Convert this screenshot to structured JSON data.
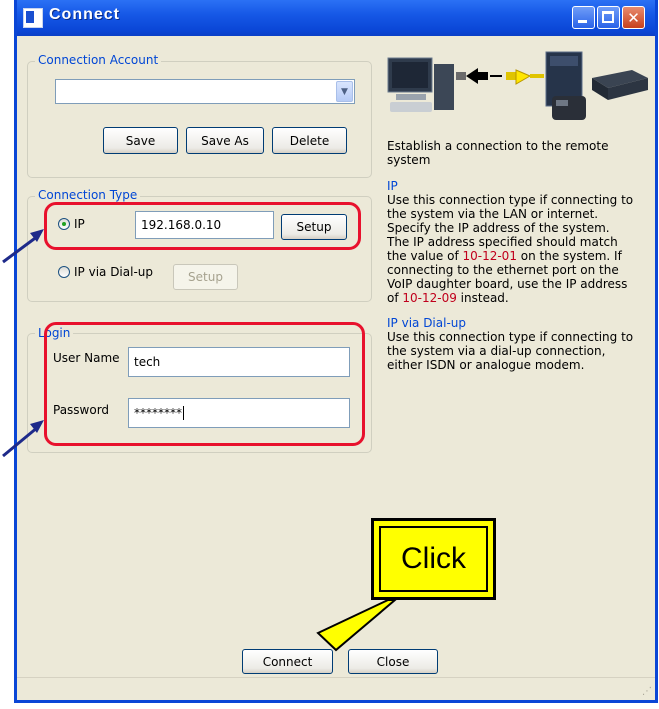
{
  "window": {
    "title": "Connect"
  },
  "connection_account": {
    "legend": "Connection Account",
    "account_select_value": "",
    "save_label": "Save",
    "save_as_label": "Save As",
    "delete_label": "Delete"
  },
  "connection_type": {
    "legend": "Connection Type",
    "ip_label": "IP",
    "ip_value": "192.168.0.10",
    "setup_label": "Setup",
    "dialup_label": "IP via Dial-up",
    "dialup_setup_label": "Setup"
  },
  "login": {
    "legend": "Login",
    "username_label": "User Name",
    "username_value": "tech",
    "password_label": "Password",
    "password_value": "********"
  },
  "info": {
    "intro_line1": "Establish a connection to the remote",
    "intro_line2": "system",
    "ip_heading": "IP",
    "ip_line1": "Use this connection type if connecting to",
    "ip_line2": "the system via the LAN or internet.",
    "ip_line3": "Specify the IP address of the system.",
    "ip_line4": "The IP address specified should match",
    "ip_line5_pre": "the value of ",
    "ip_line5_code": "10-12-01",
    "ip_line5_post": " on the system. If",
    "ip_line6": "connecting to the ethernet port on the",
    "ip_line7": "VoIP daughter board, use the IP address",
    "ip_line8_pre": "of ",
    "ip_line8_code": "10-12-09",
    "ip_line8_post": " instead.",
    "dialup_heading": "IP via Dial-up",
    "dialup_line1": "Use this connection type if connecting to",
    "dialup_line2": "the system via a dial-up connection,",
    "dialup_line3": "either ISDN or analogue modem."
  },
  "buttons": {
    "connect_label": "Connect",
    "close_label": "Close"
  },
  "callout": {
    "text": "Click"
  },
  "colors": {
    "title_bar": "#0a46d6",
    "annotation_red": "#e8112d",
    "callout_yellow": "#ffff00",
    "legend_blue": "#0046d5",
    "code_red": "#c0001c"
  }
}
